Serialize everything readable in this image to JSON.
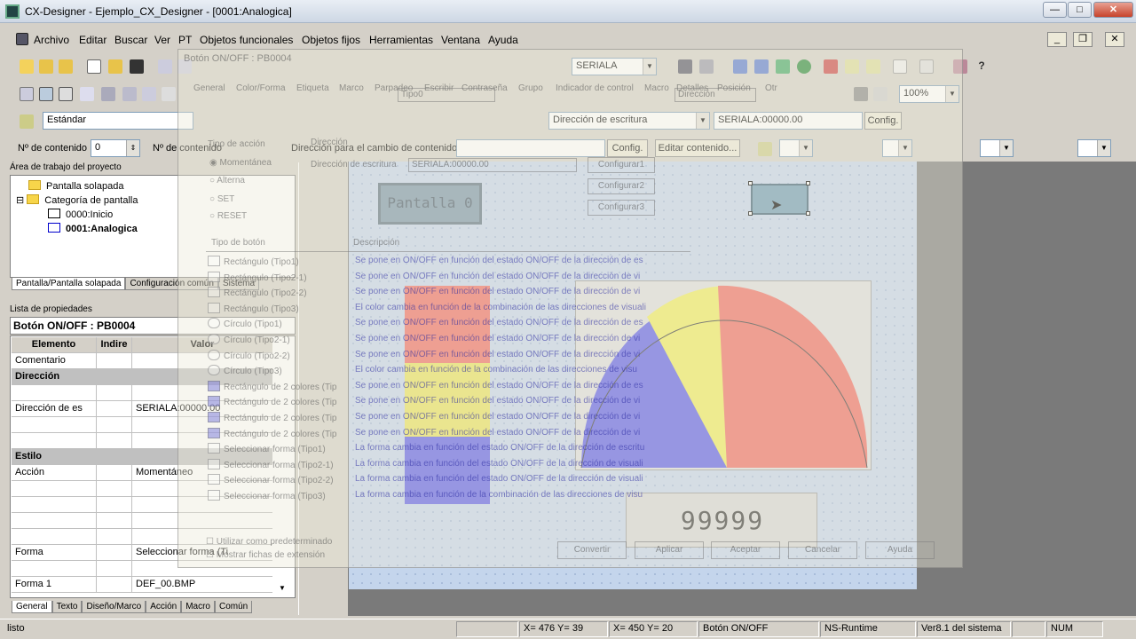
{
  "window": {
    "title": "CX-Designer - Ejemplo_CX_Designer - [0001:Analogica]"
  },
  "menu": [
    "Archivo",
    "Editar",
    "Buscar",
    "Ver",
    "PT",
    "Objetos funcionales",
    "Objetos fijos",
    "Herramientas",
    "Ventana",
    "Ayuda"
  ],
  "toolbar": {
    "serial_combo": "SERIALA",
    "style_combo": "Estándar",
    "direction_combo": "Dirección de escritura",
    "address_field": "SERIALA:00000.00",
    "config_label": "Config.",
    "zoom": "100%",
    "content_label": "Nº de contenido",
    "content_value": "0",
    "content_label2": "Nº de contenido",
    "change_dir_label": "Dirección para el cambio de contenido",
    "config2_label": "Config.",
    "edit_content_label": "Editar contenido..."
  },
  "project": {
    "header": "Área de trabajo del proyecto",
    "items": [
      "Pantalla solapada",
      "Categoría de pantalla",
      "0000:Inicio",
      "0001:Analogica"
    ],
    "tabs": [
      "Pantalla/Pantalla solapada",
      "Configuración común",
      "Sistema"
    ]
  },
  "properties": {
    "header": "Lista de propiedades",
    "object": "Botón ON/OFF : PB0004",
    "columns": [
      "Elemento",
      "Indire",
      "Valor"
    ],
    "rows": [
      {
        "name": "Comentario",
        "value": "",
        "section": false
      },
      {
        "name": "Dirección",
        "value": "",
        "section": true
      },
      {
        "name": "",
        "value": "",
        "section": false
      },
      {
        "name": "Dirección de es",
        "value": "SERIALA:00000.00",
        "section": false
      },
      {
        "name": "",
        "value": "",
        "section": false
      },
      {
        "name": "",
        "value": "",
        "section": false
      },
      {
        "name": "Estilo",
        "value": "",
        "section": true
      },
      {
        "name": "Acción",
        "value": "Momentáneo",
        "section": false
      },
      {
        "name": "",
        "value": "",
        "section": false
      },
      {
        "name": "",
        "value": "",
        "section": false
      },
      {
        "name": "",
        "value": "",
        "section": false
      },
      {
        "name": "",
        "value": "",
        "section": false
      },
      {
        "name": "Forma",
        "value": "Seleccionar forma (Ti",
        "section": false
      },
      {
        "name": "",
        "value": "",
        "section": false
      },
      {
        "name": "Forma 1",
        "value": "DEF_00.BMP",
        "section": false
      }
    ],
    "tabs": [
      "General",
      "Texto",
      "Diseño/Marco",
      "Acción",
      "Macro",
      "Común"
    ]
  },
  "canvas": {
    "pantalla_button": "Pantalla 0",
    "display": "99999"
  },
  "dialog": {
    "title": "Botón ON/OFF : PB0004",
    "tabs": [
      "General",
      "Color/Forma",
      "Etiqueta",
      "Marco",
      "Parpadeo",
      "Escribir",
      "Contraseña",
      "Grupo",
      "Indicador de control",
      "Macro",
      "Detalles",
      "Posición",
      "Otr"
    ],
    "type_label": "Tipo0",
    "action_type": "Tipo de acción",
    "actions": [
      "Momentánea",
      "Alterna",
      "SET",
      "RESET"
    ],
    "direction_label": "Dirección",
    "write_dir": "Dirección de escritura",
    "write_value": "SERIALA:00000.00",
    "configs": [
      "Configurar1",
      "Configurar2",
      "Configurar3"
    ],
    "list_headers": [
      "Tipo de botón",
      "Descripción"
    ],
    "button_types": [
      "Rectángulo (Tipo1)",
      "Rectángulo (Tipo2-1)",
      "Rectángulo (Tipo2-2)",
      "Rectángulo (Tipo3)",
      "Círculo (Tipo1)",
      "Círculo (Tipo2-1)",
      "Círculo (Tipo2-2)",
      "Círculo (Tipo3)",
      "Rectángulo de 2 colores (Tip",
      "Rectángulo de 2 colores (Tip",
      "Rectángulo de 2 colores (Tip",
      "Rectángulo de 2 colores (Tip",
      "Seleccionar forma (Tipo1)",
      "Seleccionar forma (Tipo2-1)",
      "Seleccionar forma (Tipo2-2)",
      "Seleccionar forma (Tipo3)"
    ],
    "descriptions": [
      "Se pone en ON/OFF en función del estado ON/OFF de la dirección de es",
      "Se pone en ON/OFF en función del estado ON/OFF de la dirección de vi",
      "Se pone en ON/OFF en función del estado ON/OFF de la dirección de vi",
      "El color cambia en función de la combinación de las direcciones de visuali",
      "Se pone en ON/OFF en función del estado ON/OFF de la dirección de es",
      "Se pone en ON/OFF en función del estado ON/OFF de la dirección de vi",
      "Se pone en ON/OFF en función del estado ON/OFF de la dirección de vi",
      "El color cambia en función de la combinación de las direcciones de visu",
      "Se pone en ON/OFF en función del estado ON/OFF de la dirección de es",
      "Se pone en ON/OFF en función del estado ON/OFF de la dirección de vi",
      "Se pone en ON/OFF en función del estado ON/OFF de la dirección de vi",
      "Se pone en ON/OFF en función del estado ON/OFF de la dirección de vi",
      "La forma cambia en función del estado ON/OFF de la dirección de escritu",
      "La forma cambia en función del estado ON/OFF de la dirección de visuali",
      "La forma cambia en función del estado ON/OFF de la dirección de visuali",
      "La forma cambia en función de la combinación de las direcciones de visu"
    ],
    "default_check": "Utilizar como predeterminado",
    "ext_check": "Mostrar fichas de extensión",
    "buttons": [
      "Convertir",
      "Aplicar",
      "Aceptar",
      "Cancelar",
      "Ayuda"
    ]
  },
  "status": {
    "ready": "listo",
    "coord1": "X= 476 Y=  39",
    "coord2": "X= 450 Y=  20",
    "object": "Botón ON/OFF",
    "runtime": "NS-Runtime",
    "version": "Ver8.1 del sistema",
    "num": "NUM"
  }
}
